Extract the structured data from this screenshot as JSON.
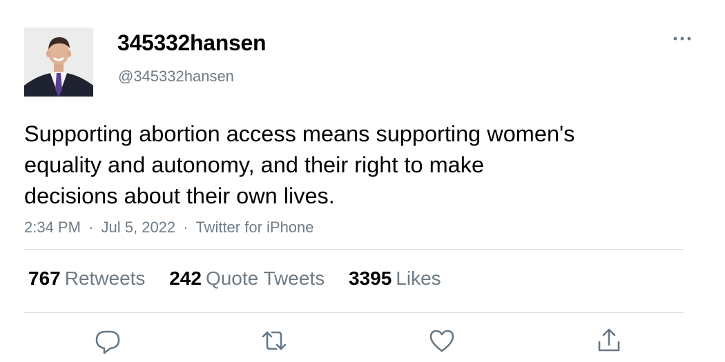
{
  "user": {
    "display_name": "345332hansen",
    "handle": "@345332hansen",
    "avatar": "profile-photo"
  },
  "tweet": {
    "text_lines": [
      "Supporting abortion access means supporting women's",
      "equality and autonomy, and their right to make",
      "decisions about their own lives."
    ],
    "time": "2:34 PM",
    "separator": "·",
    "date": "Jul 5, 2022",
    "source": "Twitter for iPhone"
  },
  "stats": [
    {
      "count": "767",
      "label": "Retweets"
    },
    {
      "count": "242",
      "label": "Quote Tweets"
    },
    {
      "count": "3395",
      "label": "Likes"
    }
  ],
  "actions": [
    "reply-icon",
    "retweet-icon",
    "like-icon",
    "share-icon"
  ],
  "colors": {
    "text": "#000000",
    "secondary": "#6e7b85",
    "divider": "#d5dbe0",
    "icon": "#657786"
  }
}
